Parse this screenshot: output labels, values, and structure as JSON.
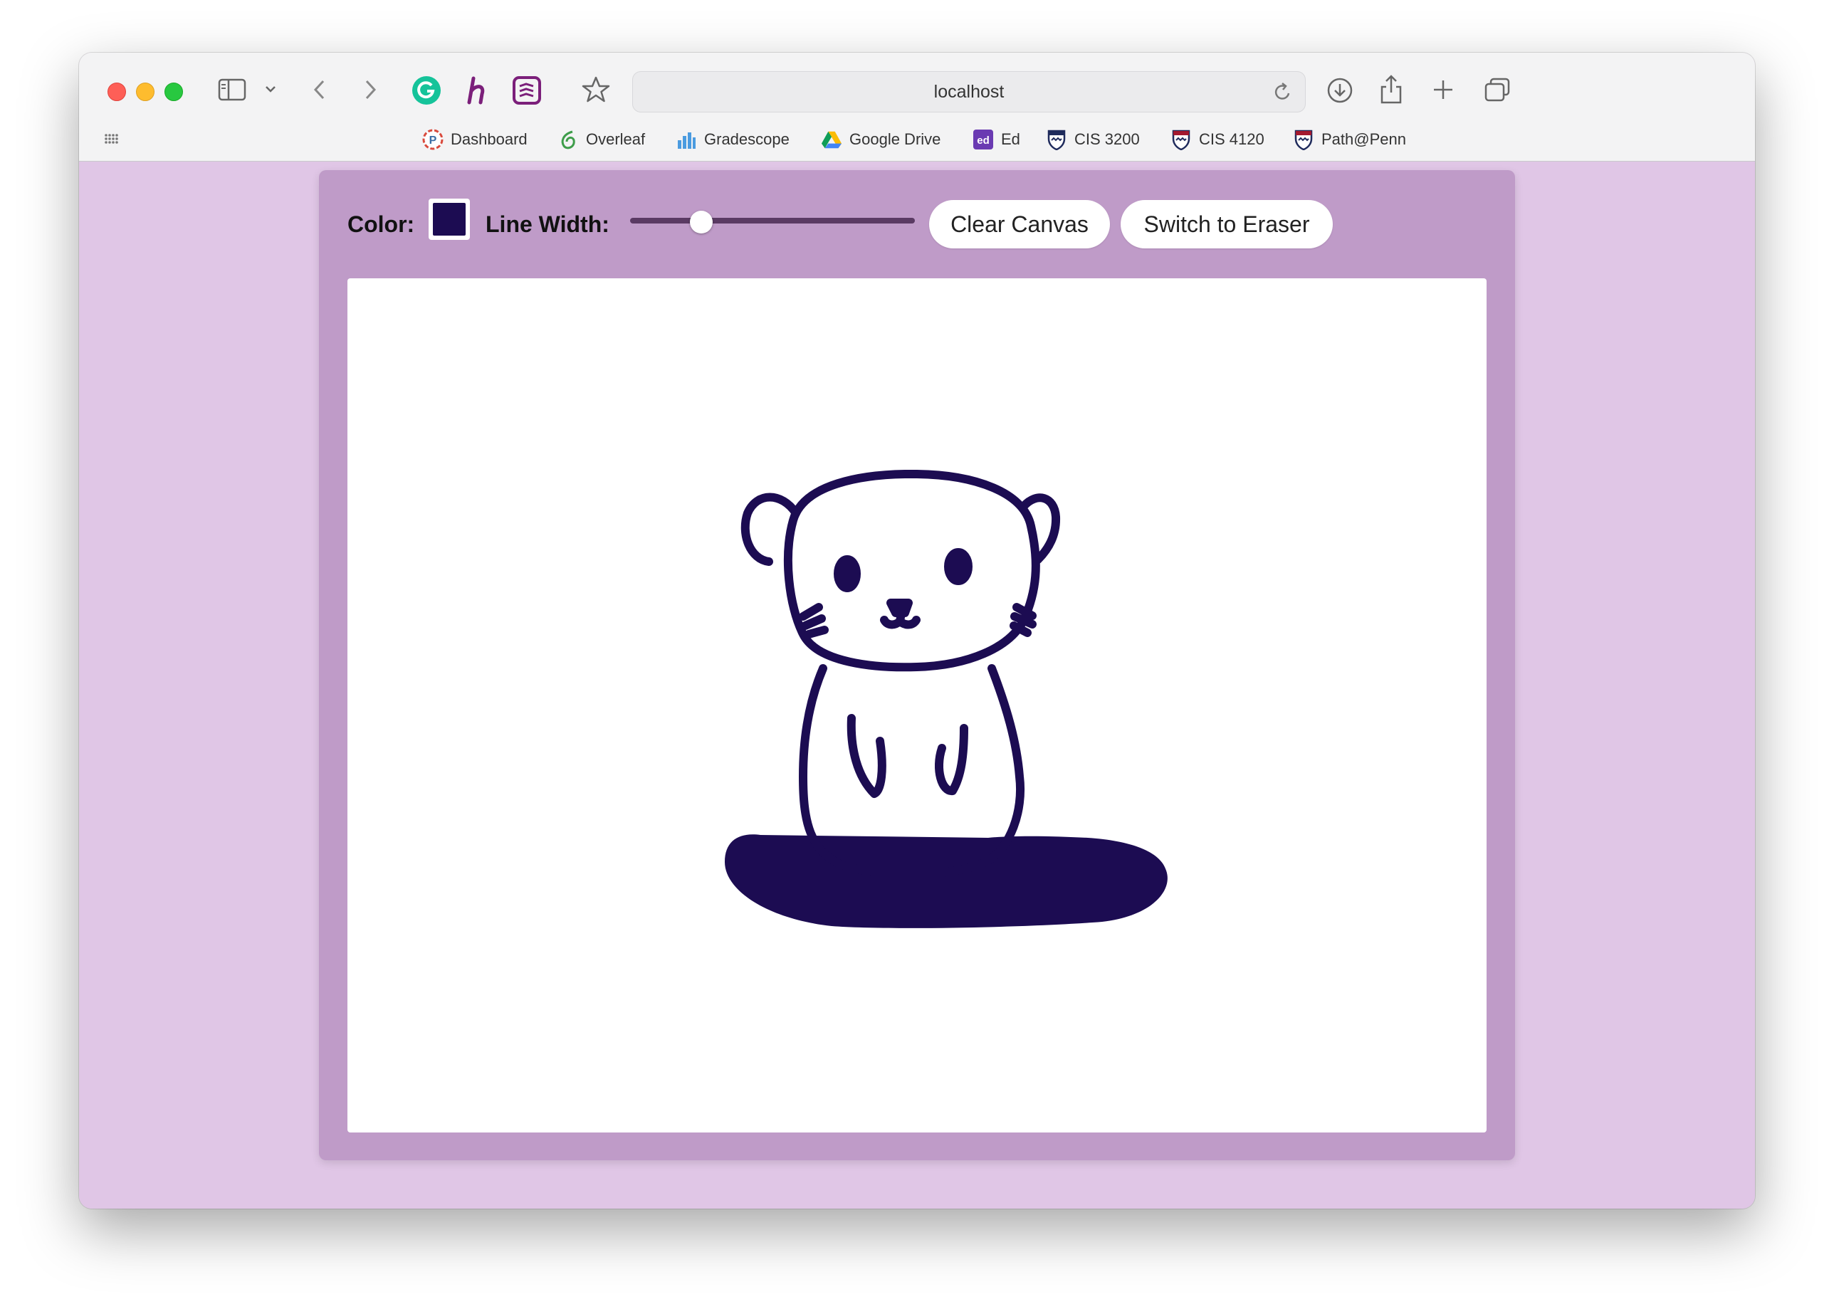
{
  "browser": {
    "url": "localhost",
    "bookmarks": [
      {
        "label": "Dashboard",
        "icon": "piazza-icon"
      },
      {
        "label": "Overleaf",
        "icon": "overleaf-icon"
      },
      {
        "label": "Gradescope",
        "icon": "gradescope-icon"
      },
      {
        "label": "Google Drive",
        "icon": "google-drive-icon"
      },
      {
        "label": "Ed",
        "icon": "ed-icon"
      },
      {
        "label": "CIS 3200",
        "icon": "penn-shield-icon"
      },
      {
        "label": "CIS 4120",
        "icon": "penn-shield-icon"
      },
      {
        "label": "Path@Penn",
        "icon": "penn-shield-icon"
      }
    ]
  },
  "toolbar": {
    "color_label": "Color:",
    "color_value": "#1c0c52",
    "line_width_label": "Line Width:",
    "line_width_fraction": 0.25,
    "clear_label": "Clear Canvas",
    "eraser_label": "Switch to Eraser"
  },
  "colors": {
    "page_bg": "#e0c6e6",
    "card_bg": "#bf9bc8",
    "ink": "#1c0c52"
  }
}
